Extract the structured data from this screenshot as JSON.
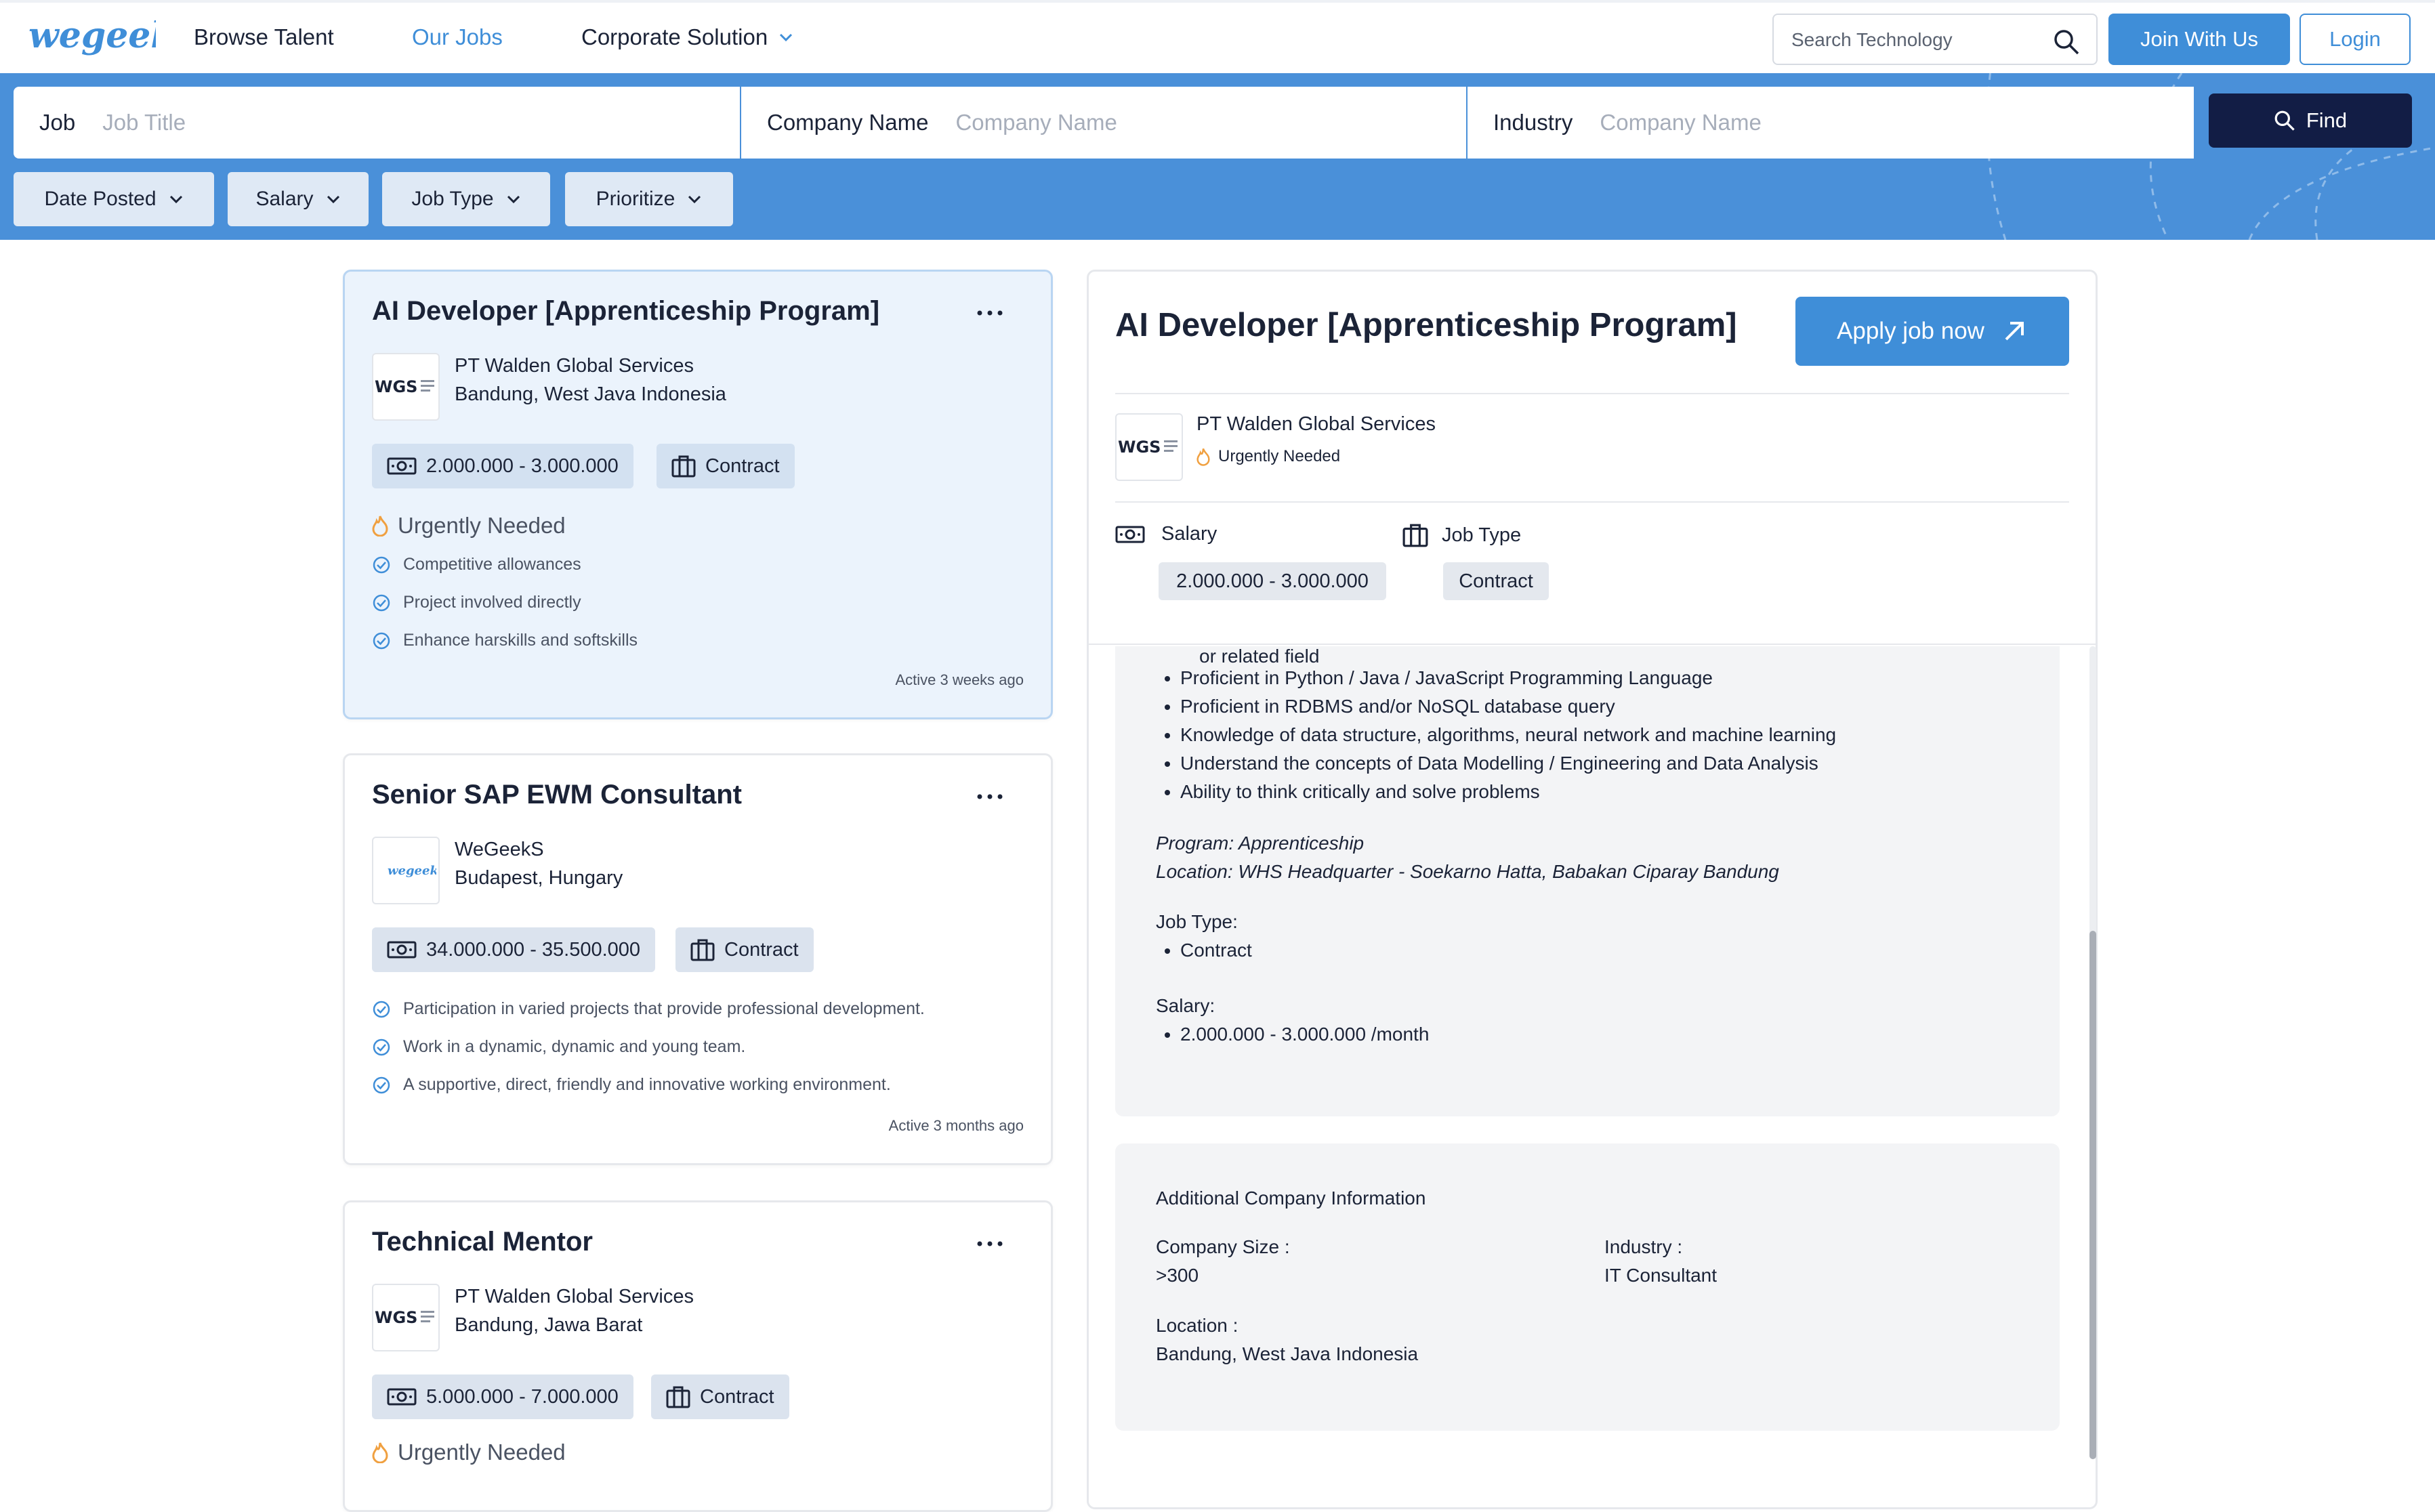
{
  "nav": {
    "logo_text": "wegeeks",
    "browse": "Browse Talent",
    "jobs": "Our Jobs",
    "corporate": "Corporate Solution",
    "search_placeholder": "Search Technology",
    "join": "Join With Us",
    "login": "Login"
  },
  "search": {
    "job_label": "Job",
    "job_placeholder": "Job Title",
    "company_label": "Company Name",
    "company_placeholder": "Company Name",
    "industry_label": "Industry",
    "industry_placeholder": "Company Name",
    "find": "Find"
  },
  "filters": [
    "Date Posted",
    "Salary",
    "Job Type",
    "Prioritize"
  ],
  "cards": [
    {
      "title": "AI Developer [Apprenticeship Program]",
      "company": "PT Walden Global Services",
      "location": "Bandung, West Java Indonesia",
      "logo": "WGS",
      "salary": "2.000.000 - 3.000.000",
      "job_type": "Contract",
      "urgent": "Urgently Needed",
      "perks": [
        "Competitive allowances",
        "Project involved directly",
        "Enhance harskills and softskills"
      ],
      "active": "Active 3 weeks ago"
    },
    {
      "title": "Senior SAP EWM Consultant",
      "company": "WeGeekS",
      "location": "Budapest, Hungary",
      "logo": "wegeeks",
      "salary": "34.000.000 - 35.500.000",
      "job_type": "Contract",
      "perks": [
        "Participation in varied projects that provide professional development.",
        "Work in a dynamic, dynamic and young team.",
        "A supportive, direct, friendly and innovative working environment."
      ],
      "active": "Active 3 months ago"
    },
    {
      "title": "Technical Mentor",
      "company": "PT Walden Global Services",
      "location": "Bandung, Jawa Barat",
      "logo": "WGS",
      "salary": "5.000.000 - 7.000.000",
      "job_type": "Contract",
      "urgent": "Urgently Needed"
    }
  ],
  "detail": {
    "title": "AI Developer [Apprenticeship Program]",
    "apply": "Apply job now",
    "company": "PT Walden Global Services",
    "logo": "WGS",
    "urgent": "Urgently Needed",
    "salary_label": "Salary",
    "salary_value": "2.000.000 - 3.000.000",
    "type_label": "Job Type",
    "type_value": "Contract",
    "desc_cut": "or related field",
    "requirements": [
      "Proficient in Python / Java / JavaScript Programming Language",
      "Proficient in RDBMS and/or NoSQL database query",
      "Knowledge of data structure, algorithms, neural network and machine learning",
      "Understand the concepts of Data Modelling / Engineering and Data Analysis",
      "Ability to think critically and solve problems"
    ],
    "program": "Program: Apprenticeship",
    "location_line": "Location: WHS Headquarter - Soekarno Hatta, Babakan Ciparay Bandung",
    "job_type_heading": "Job Type:",
    "job_type_item": "Contract",
    "salary_heading": "Salary:",
    "salary_item": "2.000.000 - 3.000.000 /month"
  },
  "company_info": {
    "heading": "Additional Company Information",
    "size_label": "Company Size :",
    "size_value": ">300",
    "industry_label": "Industry :",
    "industry_value": "IT Consultant",
    "location_label": "Location :",
    "location_value": "Bandung, West Java Indonesia"
  },
  "colors": {
    "accent": "#3f8ed8",
    "band": "#4a90d9",
    "find_button": "#121d45",
    "urgent": "#f0a040"
  }
}
